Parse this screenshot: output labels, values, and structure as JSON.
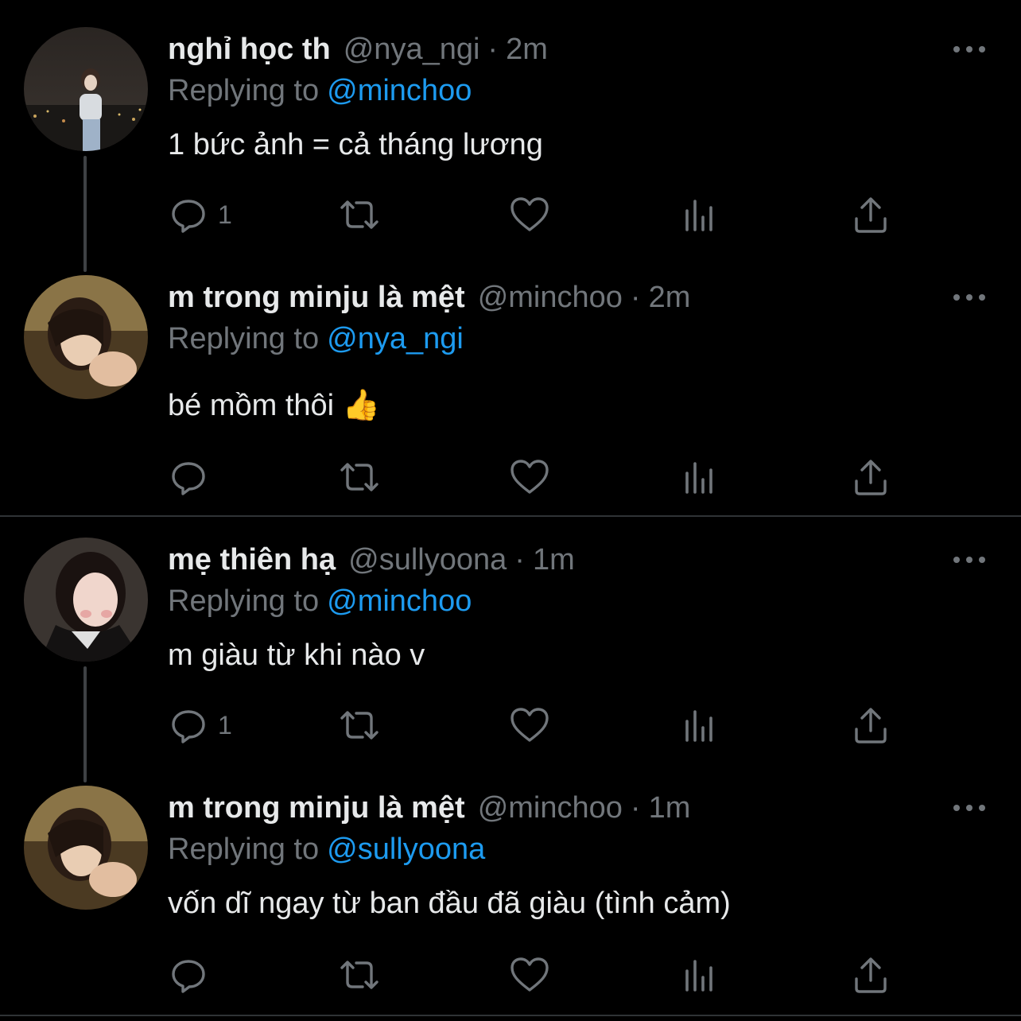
{
  "tweets": [
    {
      "name": "nghỉ học th",
      "handle": "@nya_ngi",
      "time": "2m",
      "replying_label": "Replying to",
      "replying_to": "@minchoo",
      "text": "1 bức ảnh = cả tháng lương",
      "reply_count": "1",
      "avatar_icon": "avatar-city-night"
    },
    {
      "name": "m trong minju là mệt",
      "handle": "@minchoo",
      "time": "2m",
      "replying_label": "Replying to",
      "replying_to": "@nya_ngi",
      "text": "bé mồm thôi",
      "emoji": "👍",
      "reply_count": "",
      "avatar_icon": "avatar-warm-portrait"
    },
    {
      "name": "mẹ thiên hạ",
      "handle": "@sullyoona",
      "time": "1m",
      "replying_label": "Replying to",
      "replying_to": "@minchoo",
      "text": "m giàu từ khi nào v",
      "reply_count": "1",
      "avatar_icon": "avatar-dark-portrait"
    },
    {
      "name": "m trong minju là mệt",
      "handle": "@minchoo",
      "time": "1m",
      "replying_label": "Replying to",
      "replying_to": "@sullyoona",
      "text": "vốn dĩ ngay từ ban đầu đã giàu (tình cảm)",
      "reply_count": "",
      "avatar_icon": "avatar-warm-portrait"
    }
  ],
  "separator_char": "·",
  "colors": {
    "background": "#000000",
    "primary_text": "#e7e9ea",
    "secondary_text": "#71767b",
    "link": "#1d9bf0",
    "separator": "#2f3336"
  },
  "icons": [
    "reply-icon",
    "retweet-icon",
    "like-icon",
    "views-icon",
    "share-icon",
    "more-icon"
  ]
}
